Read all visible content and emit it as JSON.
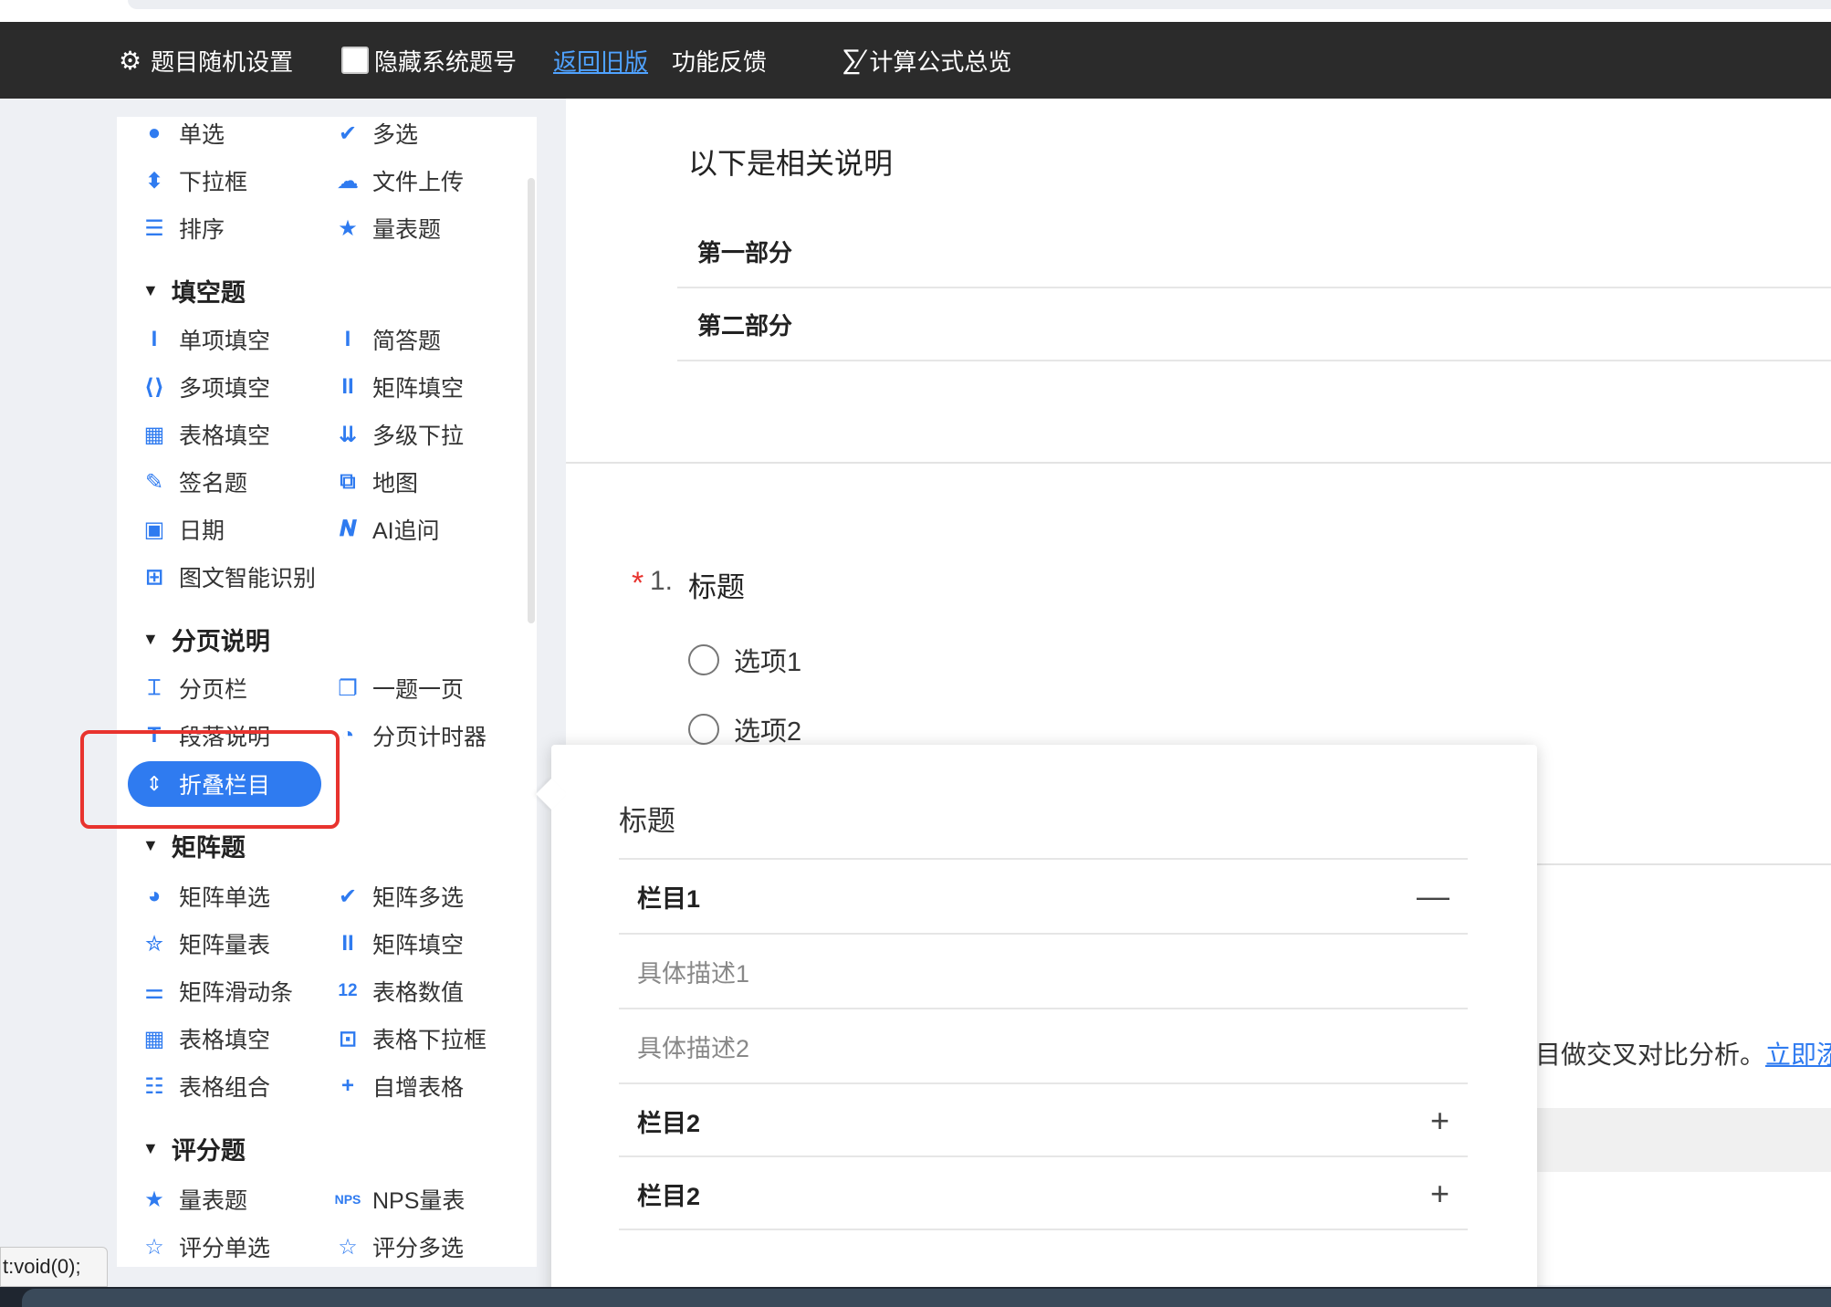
{
  "toolbar": {
    "random_settings": "题目随机设置",
    "hide_number": "隐藏系统题号",
    "old_version": "返回旧版",
    "feedback": "功能反馈",
    "formula_overview": "计算公式总览"
  },
  "sidebar": {
    "top_items": [
      {
        "label": "单选",
        "icon": "radio-dot-icon"
      },
      {
        "label": "多选",
        "icon": "checkmark-icon"
      },
      {
        "label": "下拉框",
        "icon": "sort-arrows-icon"
      },
      {
        "label": "文件上传",
        "icon": "cloud-upload-icon"
      },
      {
        "label": "排序",
        "icon": "list-icon"
      },
      {
        "label": "量表题",
        "icon": "star-icon"
      }
    ],
    "sections": [
      {
        "title": "填空题",
        "items": [
          {
            "label": "单项填空",
            "icon": "text-cursor-icon"
          },
          {
            "label": "简答题",
            "icon": "text-cursor-icon"
          },
          {
            "label": "多项填空",
            "icon": "brackets-icon"
          },
          {
            "label": "矩阵填空",
            "icon": "double-cursor-icon"
          },
          {
            "label": "表格填空",
            "icon": "table-icon"
          },
          {
            "label": "多级下拉",
            "icon": "cascade-icon"
          },
          {
            "label": "签名题",
            "icon": "pen-icon"
          },
          {
            "label": "地图",
            "icon": "map-icon"
          },
          {
            "label": "日期",
            "icon": "calendar-icon"
          },
          {
            "label": "AI追问",
            "icon": "ai-icon"
          },
          {
            "label": "图文智能识别",
            "icon": "ocr-icon"
          }
        ]
      },
      {
        "title": "分页说明",
        "items": [
          {
            "label": "分页栏",
            "icon": "page-break-icon"
          },
          {
            "label": "一题一页",
            "icon": "one-page-icon"
          },
          {
            "label": "段落说明",
            "icon": "paragraph-icon"
          },
          {
            "label": "分页计时器",
            "icon": "timer-icon"
          },
          {
            "label": "折叠栏目",
            "icon": "collapse-icon"
          }
        ]
      },
      {
        "title": "矩阵题",
        "items": [
          {
            "label": "矩阵单选",
            "icon": "matrix-radio-icon"
          },
          {
            "label": "矩阵多选",
            "icon": "matrix-check-icon"
          },
          {
            "label": "矩阵量表",
            "icon": "matrix-star-icon"
          },
          {
            "label": "矩阵填空",
            "icon": "double-cursor-icon"
          },
          {
            "label": "矩阵滑动条",
            "icon": "slider-icon"
          },
          {
            "label": "表格数值",
            "icon": "number-icon"
          },
          {
            "label": "表格填空",
            "icon": "table-icon"
          },
          {
            "label": "表格下拉框",
            "icon": "dropdown-box-icon"
          },
          {
            "label": "表格组合",
            "icon": "combo-icon"
          },
          {
            "label": "自增表格",
            "icon": "plus-icon"
          }
        ]
      },
      {
        "title": "评分题",
        "items": [
          {
            "label": "量表题",
            "icon": "star-icon"
          },
          {
            "label": "NPS量表",
            "icon": "nps-icon"
          },
          {
            "label": "评分单选",
            "icon": "star-outline-icon"
          },
          {
            "label": "评分多选",
            "icon": "star-outline-icon"
          }
        ]
      }
    ]
  },
  "status_tip": "t:void(0);",
  "main": {
    "intro_title": "以下是相关说明",
    "parts": [
      "第一部分",
      "第二部分"
    ],
    "question": {
      "required_mark": "*",
      "number": "1.",
      "title": "标题",
      "options": [
        "选项1",
        "选项2"
      ]
    },
    "cross_text": "目做交叉对比分析。",
    "cross_link": "立即添"
  },
  "preview": {
    "title": "标题",
    "rows": [
      {
        "type": "head",
        "label": "栏目1",
        "sign": "—"
      },
      {
        "type": "desc",
        "label": "具体描述1"
      },
      {
        "type": "desc",
        "label": "具体描述2"
      },
      {
        "type": "head",
        "label": "栏目2",
        "sign": "+"
      },
      {
        "type": "head",
        "label": "栏目2",
        "sign": "+"
      }
    ]
  },
  "colors": {
    "accent": "#2f7bf0",
    "toolbar_bg": "#2b2b2b",
    "highlight_border": "#e8332e"
  }
}
